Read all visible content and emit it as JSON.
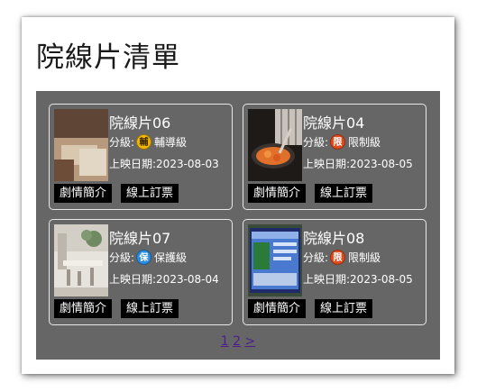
{
  "page_title": "院線片清單",
  "movies": [
    {
      "name": "院線片06",
      "rating_label": "分級:",
      "rating_icon_char": "輔",
      "rating_icon_color": "#f2b705",
      "rating_text": "輔導級",
      "release_label": "上映日期:",
      "release_date": "2023-08-03",
      "synopsis_label": "劇情簡介",
      "ticket_label": "線上訂票",
      "thumb_icon": "movie-still-desk-image"
    },
    {
      "name": "院線片04",
      "rating_label": "分級:",
      "rating_icon_char": "限",
      "rating_icon_color": "#e04a1c",
      "rating_text": "限制級",
      "release_label": "上映日期:",
      "release_date": "2023-08-05",
      "synopsis_label": "劇情簡介",
      "ticket_label": "線上訂票",
      "thumb_icon": "movie-still-cooking-image"
    },
    {
      "name": "院線片07",
      "rating_label": "分級:",
      "rating_icon_char": "保",
      "rating_icon_color": "#2a8de0",
      "rating_text": "保護級",
      "release_label": "上映日期:",
      "release_date": "2023-08-04",
      "synopsis_label": "劇情簡介",
      "ticket_label": "線上訂票",
      "thumb_icon": "movie-still-banquet-image"
    },
    {
      "name": "院線片08",
      "rating_label": "分級:",
      "rating_icon_char": "限",
      "rating_icon_color": "#e04a1c",
      "rating_text": "限制級",
      "release_label": "上映日期:",
      "release_date": "2023-08-05",
      "synopsis_label": "劇情簡介",
      "ticket_label": "線上訂票",
      "thumb_icon": "movie-still-screen-image"
    }
  ],
  "pagination": {
    "page_1": "1",
    "page_2": "2",
    "next": ">"
  }
}
